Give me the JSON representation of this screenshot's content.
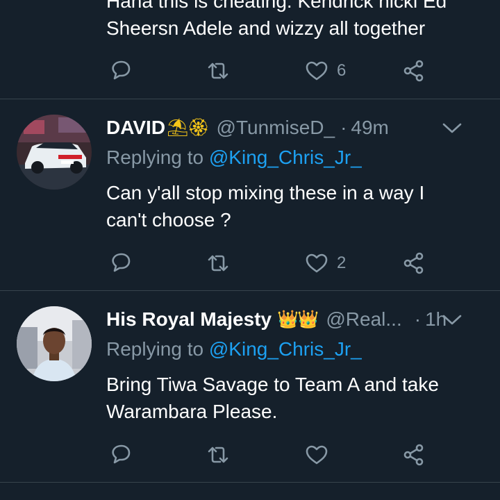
{
  "top_tweet": {
    "text_line1": "Haha this is cheating. Kendrick nicki Ed",
    "text_line2": "Sheersn Adele and wizzy all together",
    "like_count": "6"
  },
  "tweet1": {
    "name": "DAVID",
    "emoji": "⛱🏵",
    "handle": "@TunmiseD_",
    "time": "49m",
    "replying_prefix": "Replying to",
    "replying_to": "@King_Chris_Jr_",
    "text": "Can y'all stop mixing these in a way I can't choose ?",
    "like_count": "2"
  },
  "tweet2": {
    "name": "His Royal Majesty",
    "emoji": "👑👑",
    "handle": "@Real...",
    "time": "1h",
    "replying_prefix": "Replying to",
    "replying_to": "@King_Chris_Jr_",
    "text": "Bring Tiwa Savage to Team A and take Warambara Please."
  },
  "separator": "·",
  "icons": {
    "reply": "reply-icon",
    "retweet": "retweet-icon",
    "like": "like-icon",
    "share": "share-icon",
    "more": "chevron-down-icon"
  },
  "colors": {
    "background": "#15202b",
    "secondary_text": "#8899a6",
    "link": "#1da1f2",
    "divider": "#38444d"
  }
}
